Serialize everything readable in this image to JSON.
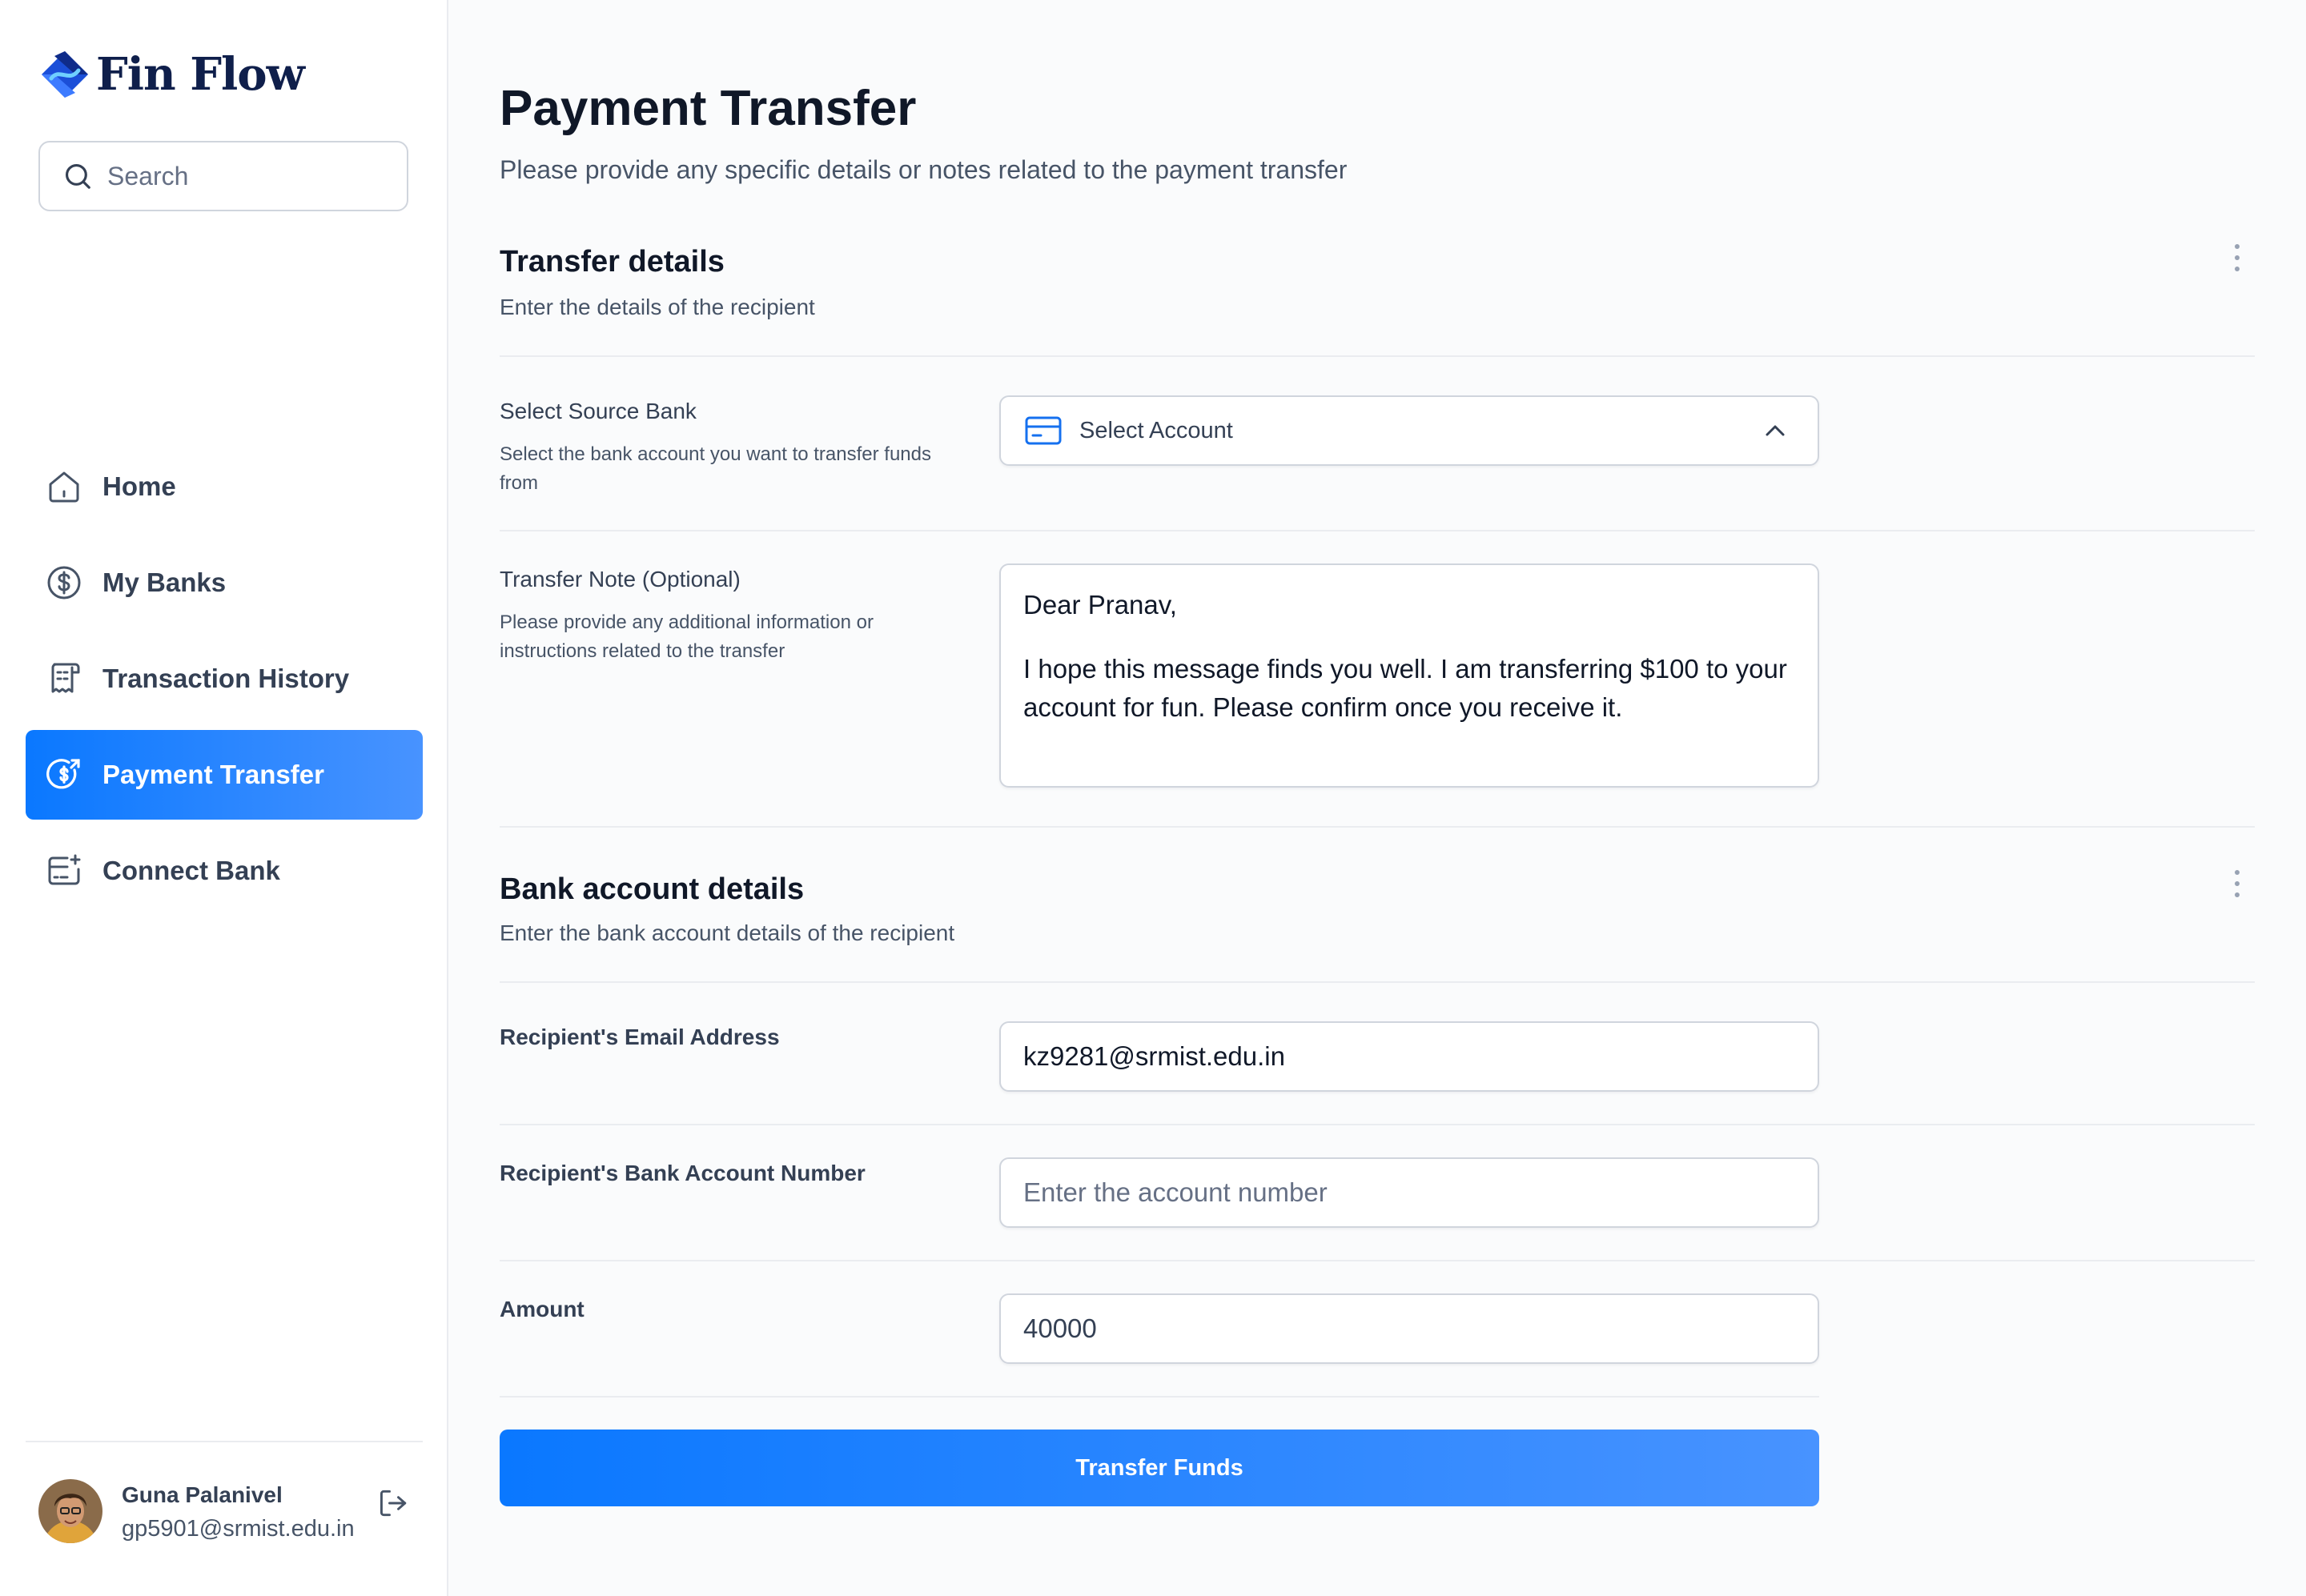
{
  "app": {
    "name": "Fin Flow"
  },
  "search": {
    "placeholder": "Search",
    "icon": "search-icon"
  },
  "sidebar": {
    "items": [
      {
        "label": "Home",
        "icon": "home-icon",
        "active": false
      },
      {
        "label": "My Banks",
        "icon": "dollar-circle-icon",
        "active": false
      },
      {
        "label": "Transaction History",
        "icon": "receipt-icon",
        "active": false
      },
      {
        "label": "Payment Transfer",
        "icon": "money-send-icon",
        "active": true
      },
      {
        "label": "Connect Bank",
        "icon": "card-add-icon",
        "active": false
      }
    ]
  },
  "user": {
    "name": "Guna Palanivel",
    "email": "gp5901@srmist.edu.in"
  },
  "page": {
    "title": "Payment Transfer",
    "subtitle": "Please provide any specific details or notes related to the payment transfer"
  },
  "transfer_details": {
    "title": "Transfer details",
    "subtitle": "Enter the details of the recipient",
    "source_bank": {
      "label": "Select Source Bank",
      "help": "Select the bank account you want to transfer funds from",
      "value": "Select Account"
    },
    "note": {
      "label": "Transfer Note (Optional)",
      "help": "Please provide any additional information or instructions related to the transfer",
      "line1": "Dear Pranav,",
      "line2": "I hope this message finds you well. I am transferring $100 to your account for fun. Please confirm once you receive it."
    }
  },
  "bank_details": {
    "title": "Bank account details",
    "subtitle": "Enter the bank account details of the recipient",
    "email": {
      "label": "Recipient's Email Address",
      "value": "kz9281@srmist.edu.in"
    },
    "account": {
      "label": "Recipient's Bank Account Number",
      "placeholder": "Enter the account number"
    },
    "amount": {
      "label": "Amount",
      "value": "40000"
    }
  },
  "submit_label": "Transfer Funds",
  "colors": {
    "accent": "#0a78ff",
    "accent_end": "#4893ff",
    "brand_text": "#0f1f4b",
    "border": "#d0d5dd",
    "background": "#fafbfc"
  }
}
